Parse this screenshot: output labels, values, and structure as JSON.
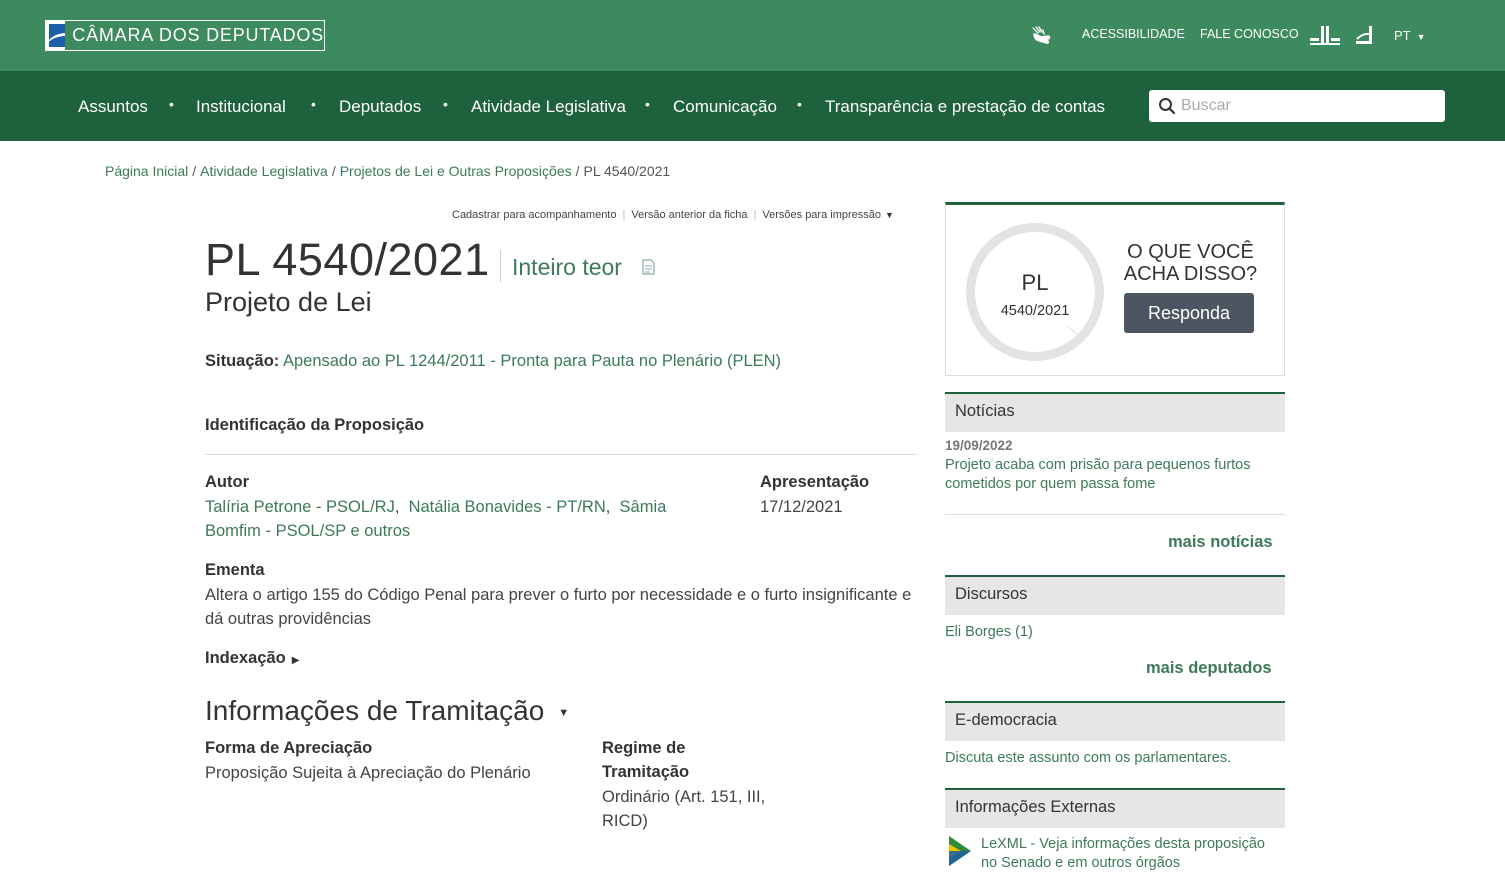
{
  "header": {
    "logo_text": "CÂMARA DOS DEPUTADOS",
    "accessibility": "ACESSIBILIDADE",
    "contact": "FALE CONOSCO",
    "language": "PT"
  },
  "nav": {
    "items": [
      "Assuntos",
      "Institucional",
      "Deputados",
      "Atividade Legislativa",
      "Comunicação",
      "Transparência e prestação de contas"
    ],
    "search_placeholder": "Buscar"
  },
  "breadcrumb": [
    "Página Inicial",
    "Atividade Legislativa",
    "Projetos de Lei e Outras Proposições",
    "PL 4540/2021"
  ],
  "tools": [
    "Cadastrar para acompanhamento",
    "Versão anterior da ficha",
    "Versões para impressão"
  ],
  "proposal": {
    "title": "PL 4540/2021",
    "full_text_link": "Inteiro teor",
    "type": "Projeto de Lei",
    "situation_label": "Situação:",
    "situation_value": "Apensado ao PL 1244/2011 - Pronta para Pauta no Plenário (PLEN)",
    "identification_heading": "Identificação da Proposição",
    "author_label": "Autor",
    "authors": [
      "Talíria Petrone - PSOL/RJ",
      "Natália Bonavides - PT/RN",
      "Sâmia Bomfim - PSOL/SP"
    ],
    "authors_more": "e outros",
    "presentation_label": "Apresentação",
    "presentation_date": "17/12/2021",
    "ementa_label": "Ementa",
    "ementa_text": "Altera o artigo 155 do Código Penal para prever o furto por necessidade e o furto insignificante e dá outras providências",
    "indexacao_label": "Indexação"
  },
  "tramitacao": {
    "title": "Informações de Tramitação",
    "forma_label": "Forma de Apreciação",
    "forma_value": "Proposição Sujeita à Apreciação do Plenário",
    "regime_label_1": "Regime de",
    "regime_label_2": "Tramitação",
    "regime_value_1": "Ordinário (Art. 151, III,",
    "regime_value_2": "RICD)"
  },
  "sidebar": {
    "poll": {
      "pl": "PL",
      "number": "4540/2021",
      "question_1": "O QUE VOCÊ",
      "question_2": "ACHA DISSO?",
      "button": "Responda"
    },
    "news": {
      "heading": "Notícias",
      "date": "19/09/2022",
      "text": "Projeto acaba com prisão para pequenos furtos cometidos por quem passa fome",
      "more": "mais notícias"
    },
    "speeches": {
      "heading": "Discursos",
      "item": "Eli Borges (1)",
      "more": "mais deputados"
    },
    "edemocracia": {
      "heading": "E-democracia",
      "text": "Discuta este assunto com os parlamentares."
    },
    "external": {
      "heading": "Informações Externas",
      "text": "LeXML - Veja informações desta proposição no Senado e em outros órgãos"
    }
  }
}
